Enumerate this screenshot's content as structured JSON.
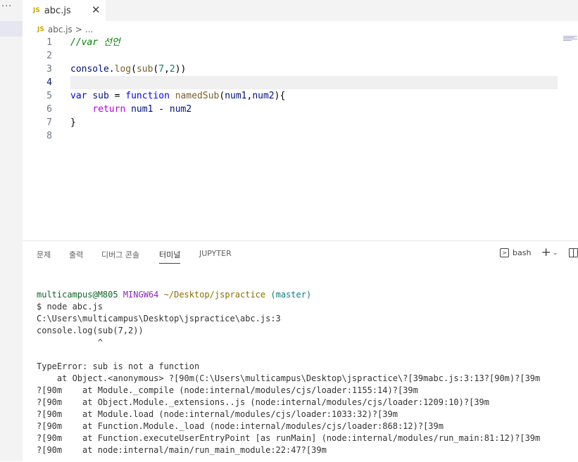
{
  "activity": {
    "more_label": "···"
  },
  "tab": {
    "badge": "JS",
    "label": "abc.js",
    "close": "✕"
  },
  "breadcrumb": {
    "badge": "JS",
    "file": "abc.js",
    "sep": ">",
    "more": "..."
  },
  "editor": {
    "lines": [
      {
        "n": "1",
        "tokens": [
          {
            "t": "//var 선언",
            "c": "tk-comment"
          }
        ]
      },
      {
        "n": "2",
        "tokens": []
      },
      {
        "n": "3",
        "tokens": [
          {
            "t": "console",
            "c": "tk-var"
          },
          {
            "t": ".",
            "c": ""
          },
          {
            "t": "log",
            "c": "tk-fn"
          },
          {
            "t": "(",
            "c": ""
          },
          {
            "t": "sub",
            "c": "tk-fn"
          },
          {
            "t": "(",
            "c": ""
          },
          {
            "t": "7",
            "c": "tk-num"
          },
          {
            "t": ",",
            "c": ""
          },
          {
            "t": "2",
            "c": "tk-num"
          },
          {
            "t": "))",
            "c": ""
          }
        ]
      },
      {
        "n": "4",
        "tokens": [],
        "current": true
      },
      {
        "n": "5",
        "tokens": [
          {
            "t": "var",
            "c": "tk-kw"
          },
          {
            "t": " ",
            "c": ""
          },
          {
            "t": "sub",
            "c": "tk-var"
          },
          {
            "t": " = ",
            "c": ""
          },
          {
            "t": "function",
            "c": "tk-kw"
          },
          {
            "t": " ",
            "c": ""
          },
          {
            "t": "namedSub",
            "c": "tk-def"
          },
          {
            "t": "(",
            "c": ""
          },
          {
            "t": "num1",
            "c": "tk-var"
          },
          {
            "t": ",",
            "c": ""
          },
          {
            "t": "num2",
            "c": "tk-var"
          },
          {
            "t": "){",
            "c": ""
          }
        ]
      },
      {
        "n": "6",
        "tokens": [
          {
            "t": "    ",
            "c": ""
          },
          {
            "t": "return",
            "c": "tk-ctl"
          },
          {
            "t": " ",
            "c": ""
          },
          {
            "t": "num1",
            "c": "tk-var"
          },
          {
            "t": " - ",
            "c": ""
          },
          {
            "t": "num2",
            "c": "tk-var"
          }
        ]
      },
      {
        "n": "7",
        "tokens": [
          {
            "t": "}",
            "c": ""
          }
        ]
      },
      {
        "n": "8",
        "tokens": []
      }
    ]
  },
  "panel": {
    "tabs": [
      {
        "label": "문제"
      },
      {
        "label": "출력"
      },
      {
        "label": "디버그 콘솔"
      },
      {
        "label": "터미널",
        "active": true
      },
      {
        "label": "JUPYTER"
      }
    ],
    "shell_label": "bash",
    "plus": "+",
    "chevron": "⌄"
  },
  "terminal": {
    "prompt": {
      "user": "multicampus@M805",
      "env": "MINGW64",
      "path": "~/Desktop/jspractice",
      "branch": "(master)"
    },
    "lines": [
      "$ node abc.js",
      "C:\\Users\\multicampus\\Desktop\\jspractice\\abc.js:3",
      "console.log(sub(7,2))",
      "            ^",
      "",
      "TypeError: sub is not a function",
      "    at Object.<anonymous> ?[90m(C:\\Users\\multicampus\\Desktop\\jspractice\\?[39mabc.js:3:13?[90m)?[39m",
      "?[90m    at Module._compile (node:internal/modules/cjs/loader:1155:14)?[39m",
      "?[90m    at Object.Module._extensions..js (node:internal/modules/cjs/loader:1209:10)?[39m",
      "?[90m    at Module.load (node:internal/modules/cjs/loader:1033:32)?[39m",
      "?[90m    at Function.Module._load (node:internal/modules/cjs/loader:868:12)?[39m",
      "?[90m    at Function.executeUserEntryPoint [as runMain] (node:internal/modules/run_main:81:12)?[39m",
      "?[90m    at node:internal/main/run_main_module:22:47?[39m"
    ]
  }
}
